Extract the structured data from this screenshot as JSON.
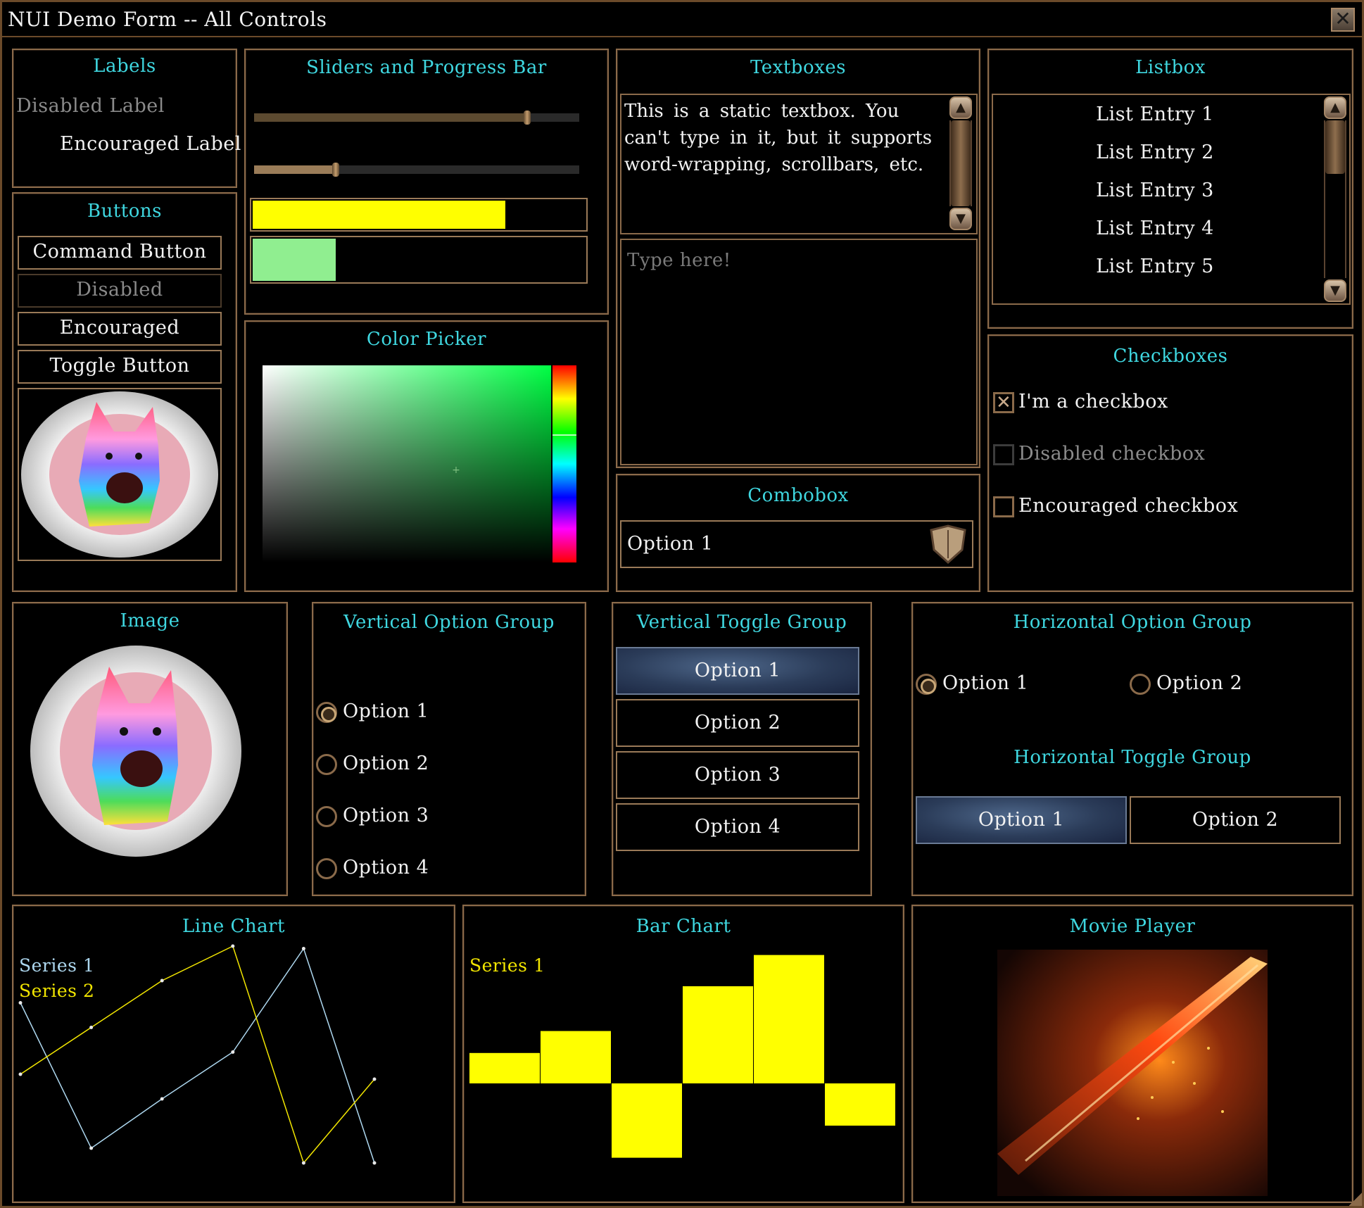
{
  "window": {
    "title": "NUI Demo Form -- All Controls"
  },
  "labels": {
    "title": "Labels",
    "disabled": "Disabled Label",
    "encouraged": "Encouraged Label"
  },
  "buttons": {
    "title": "Buttons",
    "command": "Command Button",
    "disabled": "Disabled",
    "encouraged": "Encouraged",
    "toggle": "Toggle Button"
  },
  "sliders": {
    "title": "Sliders and Progress Bar",
    "slider1_value": 0.84,
    "slider2_value": 0.25,
    "progress1_value": 0.76,
    "progress1_color": "#ffff00",
    "progress2_value": 0.25,
    "progress2_color": "#90ee90"
  },
  "color_picker": {
    "title": "Color Picker",
    "selected_hue_color": "#00ff44"
  },
  "textboxes": {
    "title": "Textboxes",
    "static_text": "This is a static textbox. You can't type in it, but it supports word-wrapping, scrollbars, etc.",
    "input_placeholder": "Type here!"
  },
  "combobox": {
    "title": "Combobox",
    "selected": "Option 1",
    "dropdown_icon": "shield-dropdown-icon"
  },
  "listbox": {
    "title": "Listbox",
    "items": [
      "List Entry 1",
      "List Entry 2",
      "List Entry 3",
      "List Entry 4",
      "List Entry 5"
    ]
  },
  "checkboxes": {
    "title": "Checkboxes",
    "items": [
      {
        "label": "I'm a checkbox",
        "checked": true
      },
      {
        "label": "Disabled checkbox",
        "disabled": true
      },
      {
        "label": "Encouraged checkbox",
        "checked": false
      }
    ]
  },
  "image": {
    "title": "Image",
    "alt": "corgi-portrait"
  },
  "vertical_option_group": {
    "title": "Vertical Option Group",
    "options": [
      "Option 1",
      "Option 2",
      "Option 3",
      "Option 4"
    ],
    "selected": 0
  },
  "vertical_toggle_group": {
    "title": "Vertical Toggle Group",
    "options": [
      "Option 1",
      "Option 2",
      "Option 3",
      "Option 4"
    ],
    "selected": 0
  },
  "horizontal_option_group": {
    "title": "Horizontal Option Group",
    "options": [
      "Option 1",
      "Option 2"
    ],
    "selected": 0
  },
  "horizontal_toggle_group": {
    "title": "Horizontal Toggle Group",
    "options": [
      "Option 1",
      "Option 2"
    ],
    "selected": 0
  },
  "line_chart": {
    "title": "Line Chart"
  },
  "bar_chart": {
    "title": "Bar Chart"
  },
  "movie_player": {
    "title": "Movie Player"
  },
  "colors": {
    "accent": "#3fd7e0",
    "border": "#8b6a4a",
    "series1": "#aed8f0",
    "series2": "#f2e600",
    "bar": "#ffff00"
  },
  "chart_data": [
    {
      "type": "line",
      "title": "Line Chart",
      "series": [
        {
          "name": "Series 1",
          "x": [
            0,
            1,
            2,
            3,
            4,
            5
          ],
          "values": [
            0.75,
            0.16,
            0.36,
            0.55,
            0.97,
            0.1
          ]
        },
        {
          "name": "Series 2",
          "x": [
            0,
            1,
            2,
            3,
            4,
            5
          ],
          "values": [
            0.46,
            0.65,
            0.84,
            0.98,
            0.1,
            0.44
          ]
        }
      ]
    },
    {
      "type": "bar",
      "title": "Bar Chart",
      "series": [
        {
          "name": "Series 1",
          "values": [
            0.36,
            0.62,
            -0.88,
            1.15,
            1.52,
            -0.5
          ]
        }
      ]
    }
  ]
}
